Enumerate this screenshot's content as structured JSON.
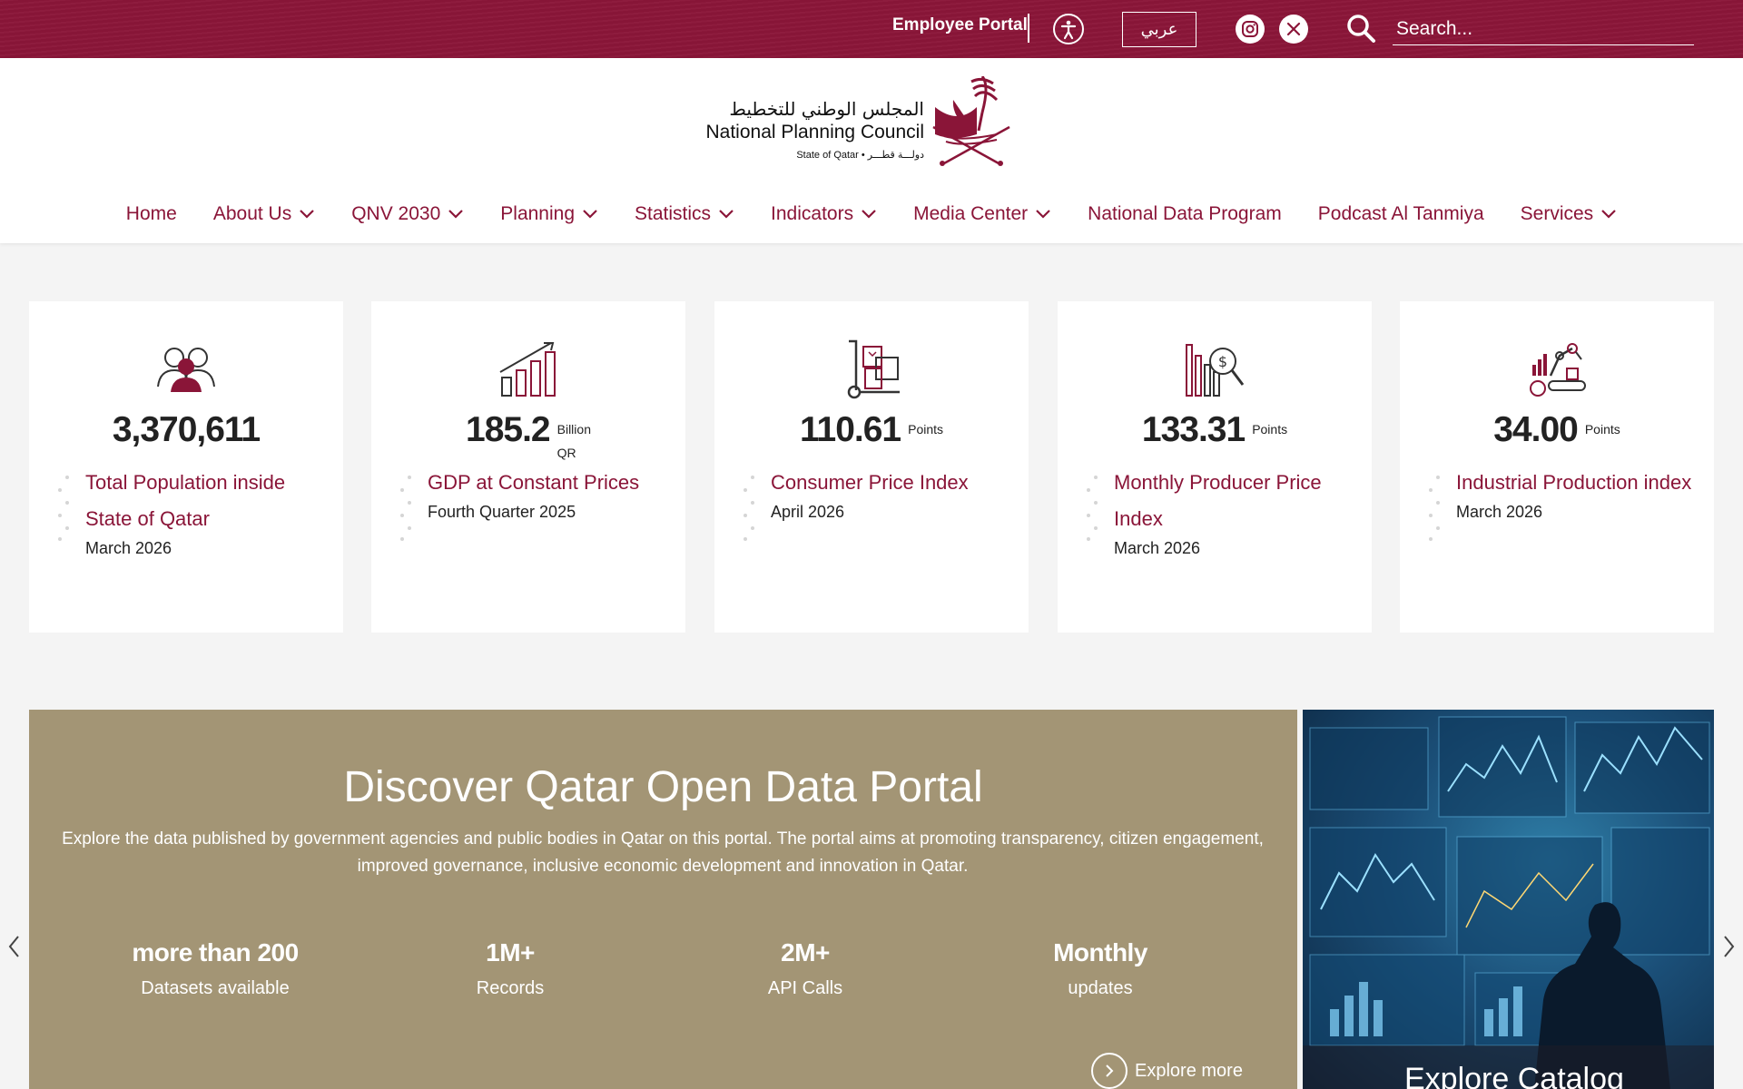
{
  "topbar": {
    "employee_portal": "Employee Portal",
    "language_button": "عربي",
    "search_placeholder": "Search..."
  },
  "logo": {
    "arabic": "المجلس الوطني للتخطيط",
    "english": "National Planning Council",
    "subtitle": "State of Qatar • دولـــة قطـــر"
  },
  "nav": [
    {
      "label": "Home",
      "dropdown": false
    },
    {
      "label": "About Us",
      "dropdown": true
    },
    {
      "label": "QNV 2030",
      "dropdown": true
    },
    {
      "label": "Planning",
      "dropdown": true
    },
    {
      "label": "Statistics",
      "dropdown": true
    },
    {
      "label": "Indicators",
      "dropdown": true
    },
    {
      "label": "Media Center",
      "dropdown": true
    },
    {
      "label": "National Data Program",
      "dropdown": false
    },
    {
      "label": "Podcast Al Tanmiya",
      "dropdown": false
    },
    {
      "label": "Services",
      "dropdown": true
    }
  ],
  "stats": [
    {
      "icon": "population-icon",
      "value": "3,370,611",
      "unit": "",
      "unit2": "",
      "label": "Total Population inside State of Qatar",
      "period": "March 2026"
    },
    {
      "icon": "gdp-growth-chart-icon",
      "value": "185.2",
      "unit": "Billion",
      "unit2": "QR",
      "label": "GDP at Constant Prices",
      "period": "Fourth Quarter 2025"
    },
    {
      "icon": "hand-truck-boxes-icon",
      "value": "110.61",
      "unit": "Points",
      "unit2": "",
      "label": "Consumer Price Index",
      "period": "April 2026"
    },
    {
      "icon": "price-analysis-icon",
      "value": "133.31",
      "unit": "Points",
      "unit2": "",
      "label": "Monthly Producer Price Index",
      "period": "March 2026"
    },
    {
      "icon": "industrial-robot-arm-icon",
      "value": "34.00",
      "unit": "Points",
      "unit2": "",
      "label": "Industrial Production index",
      "period": "March 2026"
    }
  ],
  "banner": {
    "title": "Discover Qatar Open Data Portal",
    "description": "Explore the data published by government agencies and public bodies in Qatar on this portal. The portal aims at promoting transparency, citizen engagement, improved governance, inclusive economic development and innovation in Qatar.",
    "stats": [
      {
        "big": "more than 200",
        "small": "Datasets available"
      },
      {
        "big": "1M+",
        "small": "Records"
      },
      {
        "big": "2M+",
        "small": "API Calls"
      },
      {
        "big": "Monthly",
        "small": "updates"
      }
    ],
    "explore_label": "Explore more",
    "catalog_label": "Explore Catalog"
  },
  "colors": {
    "brand_maroon": "#8a1538",
    "banner_tan": "#a39575"
  }
}
